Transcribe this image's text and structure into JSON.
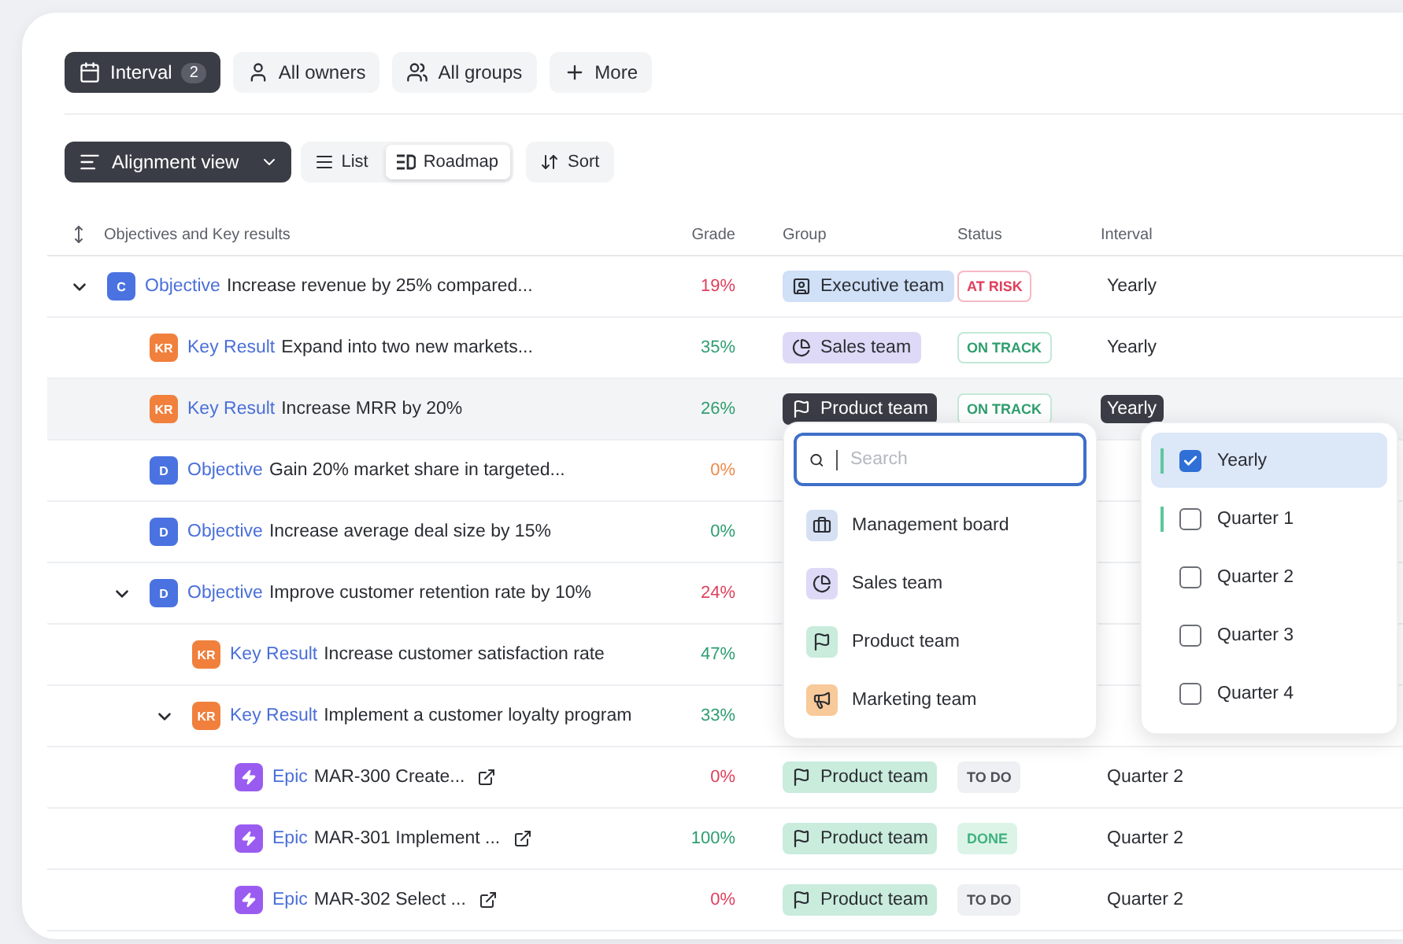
{
  "filters": [
    {
      "kind": "calendar",
      "label": "Interval",
      "count": "2",
      "selected": true
    },
    {
      "kind": "owner",
      "label": "All owners",
      "selected": false
    },
    {
      "kind": "groups",
      "label": "All groups",
      "selected": false
    },
    {
      "kind": "add",
      "label": "More",
      "selected": false
    }
  ],
  "toolbar": {
    "view_menu": {
      "label": "Alignment view"
    },
    "layouts": [
      {
        "kind": "list",
        "label": "List",
        "selected": false
      },
      {
        "kind": "roadmap",
        "label": "Roadmap",
        "selected": true
      }
    ],
    "sort": {
      "label": "Sort"
    }
  },
  "columns": [
    "Objectives and Key results",
    "Grade",
    "Group",
    "Status",
    "Interval"
  ],
  "rows": [
    {
      "kind": "objective",
      "badge": "C",
      "type": "Objective",
      "title": "Increase revenue by 25% compared...",
      "grade": "19%",
      "color": "#e0405e",
      "group": {
        "kind": "executive",
        "label": "Executive team",
        "open": false
      },
      "status": {
        "kind": "risk",
        "label": "AT RISK"
      },
      "interval": {
        "label": "Yearly",
        "open": false
      },
      "selected": false,
      "expanded": true,
      "children": [
        {
          "kind": "kr",
          "badge": "KR",
          "type": "Key Result",
          "title": "Expand into two new markets...",
          "grade": "35%",
          "color": "#2e9e6e",
          "group": {
            "kind": "sales",
            "label": "Sales team",
            "open": false
          },
          "status": {
            "kind": "track",
            "label": "ON TRACK"
          },
          "interval": {
            "label": "Yearly",
            "open": false
          },
          "selected": false
        },
        {
          "kind": "kr",
          "badge": "KR",
          "type": "Key Result",
          "title": "Increase MRR by 20%",
          "grade": "26%",
          "color": "#2e9e6e",
          "group": {
            "kind": "product",
            "label": "Product team",
            "open": true
          },
          "status": {
            "kind": "track",
            "label": "ON TRACK"
          },
          "interval": {
            "label": "Yearly",
            "open": true
          },
          "selected": true
        },
        {
          "kind": "objective",
          "badge": "D",
          "type": "Objective",
          "title": "Gain 20% market share in targeted...",
          "grade": "0%",
          "color": "#f08a4b",
          "selected": false
        },
        {
          "kind": "objective",
          "badge": "D",
          "type": "Objective",
          "title": "Increase average deal size by 15%",
          "grade": "0%",
          "color": "#2e9e6e",
          "selected": false
        },
        {
          "kind": "objective",
          "badge": "D",
          "type": "Objective",
          "title": "Improve customer retention rate by 10%",
          "grade": "24%",
          "color": "#e0405e",
          "selected": false,
          "expanded": true,
          "children": [
            {
              "kind": "kr",
              "badge": "KR",
              "type": "Key Result",
              "title": "Increase customer satisfaction rate",
              "grade": "47%",
              "color": "#2e9e6e",
              "selected": false
            },
            {
              "kind": "kr",
              "badge": "KR",
              "type": "Key Result",
              "title": "Implement a customer loyalty program",
              "grade": "33%",
              "color": "#2e9e6e",
              "selected": false,
              "expanded": true,
              "children": [
                {
                  "kind": "epic",
                  "type": "Epic",
                  "title": "MAR-300 Create...",
                  "grade": "0%",
                  "color": "#e0405e",
                  "group": {
                    "kind": "product",
                    "label": "Product team",
                    "open": false
                  },
                  "status": {
                    "kind": "todo",
                    "label": "TO DO"
                  },
                  "interval": {
                    "label": "Quarter 2",
                    "open": false
                  },
                  "selected": false
                },
                {
                  "kind": "epic",
                  "type": "Epic",
                  "title": "MAR-301 Implement ...",
                  "grade": "100%",
                  "color": "#2e9e6e",
                  "group": {
                    "kind": "product",
                    "label": "Product team",
                    "open": false
                  },
                  "status": {
                    "kind": "done",
                    "label": "DONE"
                  },
                  "interval": {
                    "label": "Quarter 2",
                    "open": false
                  },
                  "selected": false
                },
                {
                  "kind": "epic",
                  "type": "Epic",
                  "title": "MAR-302 Select ...",
                  "grade": "0%",
                  "color": "#e0405e",
                  "group": {
                    "kind": "product",
                    "label": "Product team",
                    "open": false
                  },
                  "status": {
                    "kind": "todo",
                    "label": "TO DO"
                  },
                  "interval": {
                    "label": "Quarter 2",
                    "open": false
                  },
                  "selected": false
                }
              ]
            }
          ]
        }
      ]
    }
  ],
  "group_menu": {
    "search": {
      "placeholder": "Search"
    },
    "options": [
      {
        "kind": "management",
        "label": "Management board"
      },
      {
        "kind": "sales",
        "label": "Sales team"
      },
      {
        "kind": "product",
        "label": "Product team"
      },
      {
        "kind": "marketing",
        "label": "Marketing team"
      }
    ]
  },
  "interval_menu": {
    "options": [
      {
        "label": "Yearly",
        "checked": true,
        "selected": true,
        "marked": true
      },
      {
        "label": "Quarter 1",
        "checked": false,
        "selected": false,
        "marked": true
      },
      {
        "label": "Quarter 2",
        "checked": false,
        "selected": false,
        "marked": false
      },
      {
        "label": "Quarter 3",
        "checked": false,
        "selected": false,
        "marked": false
      },
      {
        "label": "Quarter 4",
        "checked": false,
        "selected": false,
        "marked": false
      }
    ]
  }
}
